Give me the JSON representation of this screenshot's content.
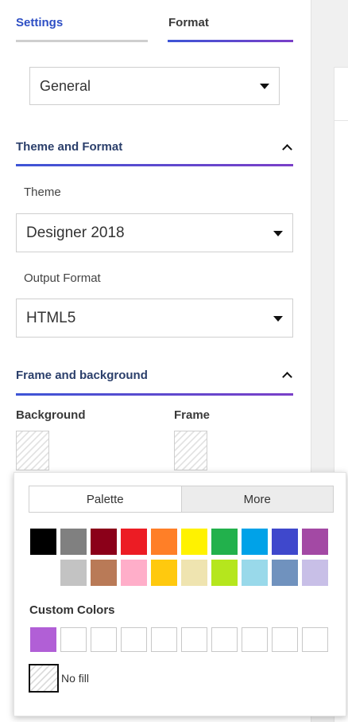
{
  "tabs": {
    "settings": "Settings",
    "format": "Format"
  },
  "category_select": {
    "value": "General"
  },
  "theme_section": {
    "title": "Theme and Format",
    "theme_label": "Theme",
    "theme_value": "Designer 2018",
    "output_label": "Output Format",
    "output_value": "HTML5"
  },
  "frame_section": {
    "title": "Frame and background",
    "background_label": "Background",
    "frame_label": "Frame"
  },
  "color_picker": {
    "palette_tab": "Palette",
    "more_tab": "More",
    "palette_row1": [
      "#000000",
      "#808080",
      "#8b0019",
      "#ec1c24",
      "#ff7f27",
      "#fff200",
      "#22b14c",
      "#00a2e8",
      "#3f48cc",
      "#a349a4"
    ],
    "palette_row2": [
      "#ffffff",
      "#c3c3c3",
      "#b97a57",
      "#ffaec9",
      "#ffc90e",
      "#efe4b0",
      "#b5e61d",
      "#99d9ea",
      "#7092be",
      "#c8bfe7"
    ],
    "custom_title": "Custom Colors",
    "custom_colors": [
      "#b15fd6",
      "",
      "",
      "",
      "",
      "",
      "",
      "",
      "",
      ""
    ],
    "no_fill_label": "No fill"
  },
  "colors": {
    "accent_blue": "#3d55d6",
    "accent_purple": "#7a3fc8",
    "tab_active_text": "#2d4ec4"
  }
}
